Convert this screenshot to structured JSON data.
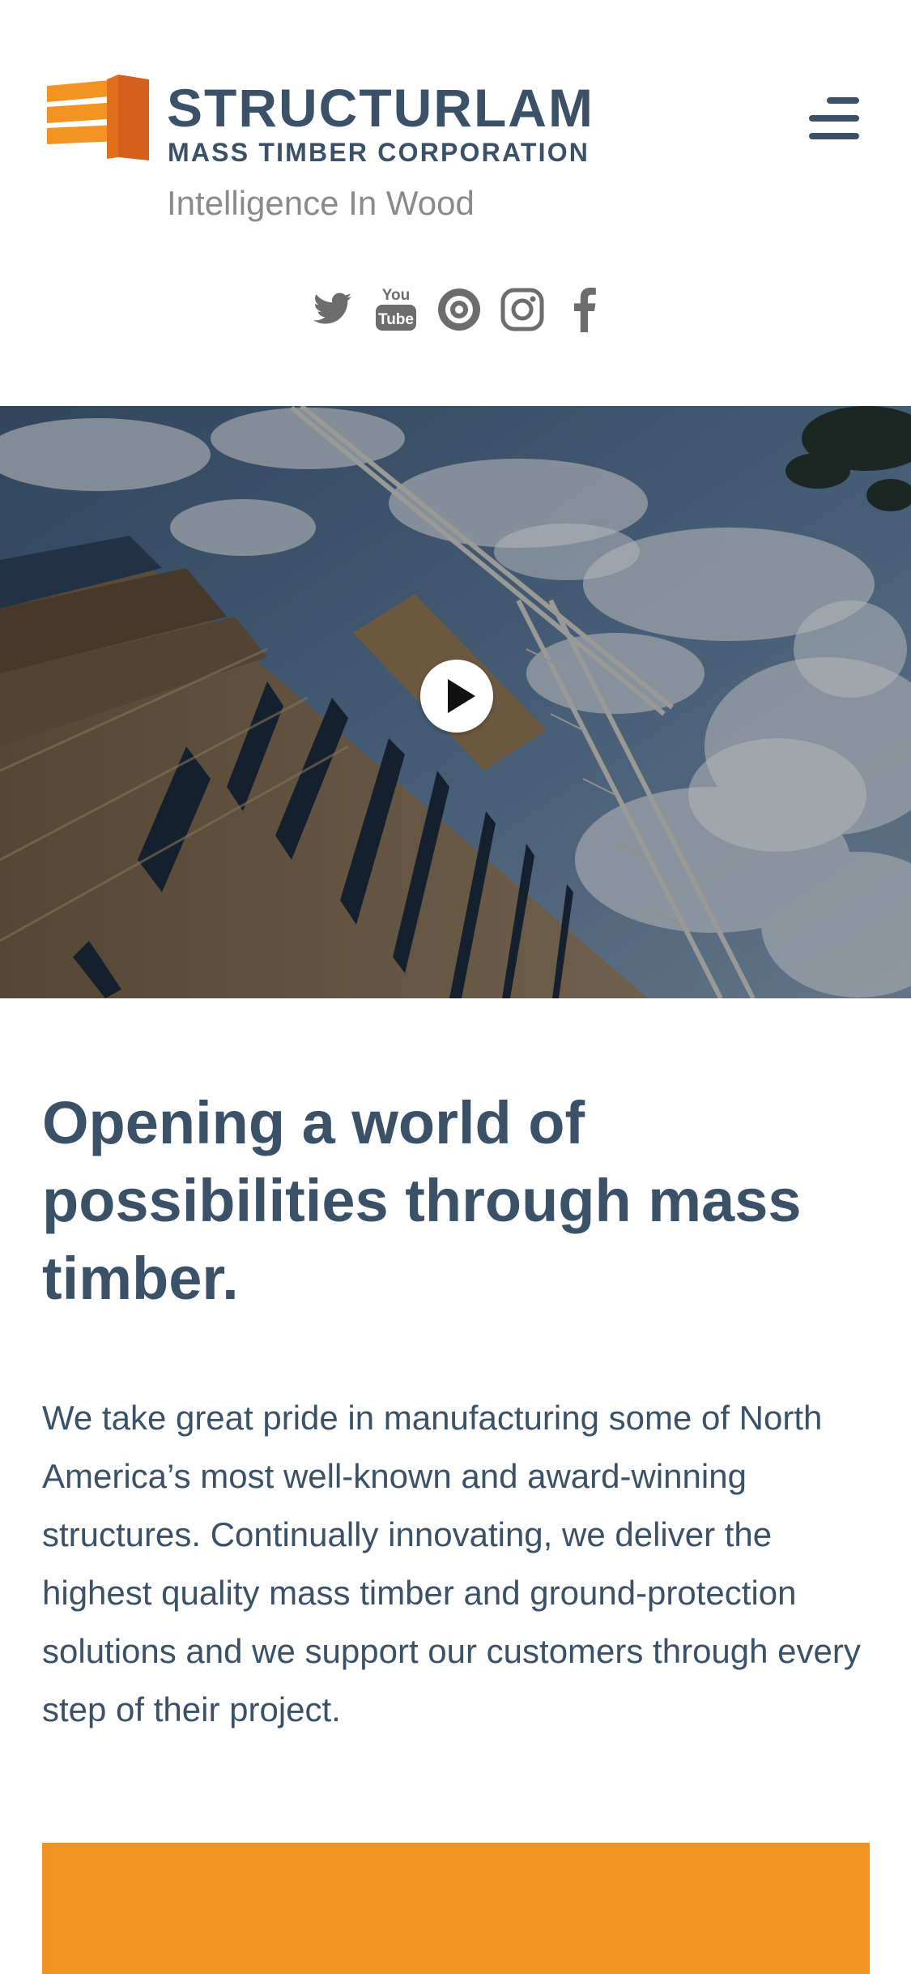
{
  "header": {
    "brand": {
      "name": "STRUCTURLAM",
      "subtitle": "MASS TIMBER CORPORATION",
      "tagline": "Intelligence In Wood"
    },
    "menu_icon": "hamburger-menu-icon"
  },
  "social": [
    {
      "name": "twitter",
      "icon": "twitter-icon"
    },
    {
      "name": "youtube",
      "icon": "youtube-icon"
    },
    {
      "name": "issuu",
      "icon": "issuu-icon"
    },
    {
      "name": "instagram",
      "icon": "instagram-icon"
    },
    {
      "name": "facebook",
      "icon": "facebook-icon"
    }
  ],
  "hero": {
    "image": "mass timber building under construction with crane and cloudy sky",
    "play_icon": "play-icon"
  },
  "main": {
    "headline": "Opening a world of possibilities through mass timber.",
    "intro": "We take great pride in manufacturing some of North America’s most well-known and award-winning structures. Continually innovating, we deliver the highest quality mass timber and ground-protection solutions and we support our customers through every step of their project."
  },
  "colors": {
    "brand_navy": "#3b5168",
    "brand_orange": "#f39322",
    "logo_orange_dark": "#d2601a",
    "tagline_gray": "#8a8a8a",
    "icon_gray": "#6d6d6d"
  }
}
